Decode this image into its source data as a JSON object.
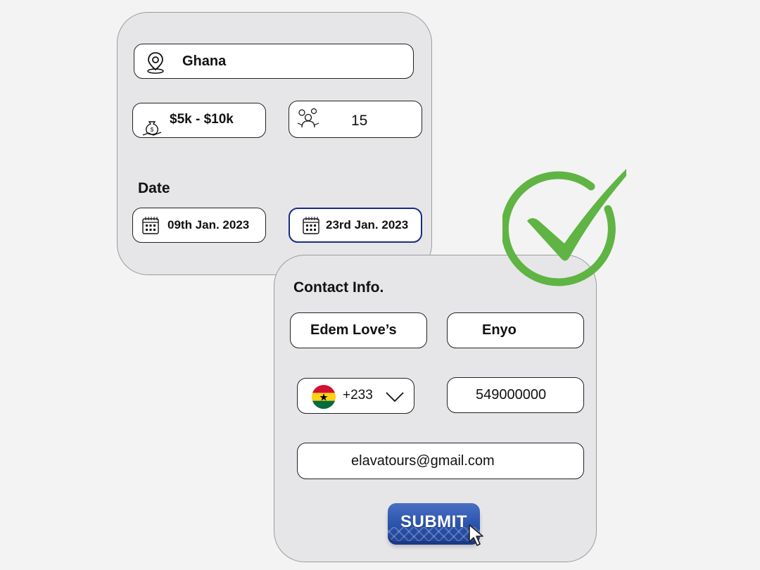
{
  "trip": {
    "location": "Ghana",
    "budget": "$5k - $10k",
    "travelers": "15",
    "date_label": "Date",
    "start_date": "09th Jan. 2023",
    "end_date": "23rd Jan. 2023"
  },
  "contact": {
    "title": "Contact Info.",
    "first_name": "Edem Love’s",
    "last_name": "Enyo",
    "country_code": "+233",
    "phone": "549000000",
    "email": "elavatours@gmail.com",
    "submit_label": "SUBMIT"
  },
  "icons": {
    "location": "map-pin-icon",
    "budget": "money-bag-icon",
    "travelers": "group-icon",
    "calendar": "calendar-icon",
    "flag": "ghana-flag-icon",
    "dropdown": "chevron-down-icon",
    "success": "check-circle-icon",
    "cursor": "pointer-cursor-icon"
  },
  "colors": {
    "card_bg": "#e6e6e8",
    "page_bg": "#f3f3f3",
    "selected_border": "#1a2a86",
    "submit_blue": "#2c54ad",
    "success_green": "#5fb443"
  }
}
